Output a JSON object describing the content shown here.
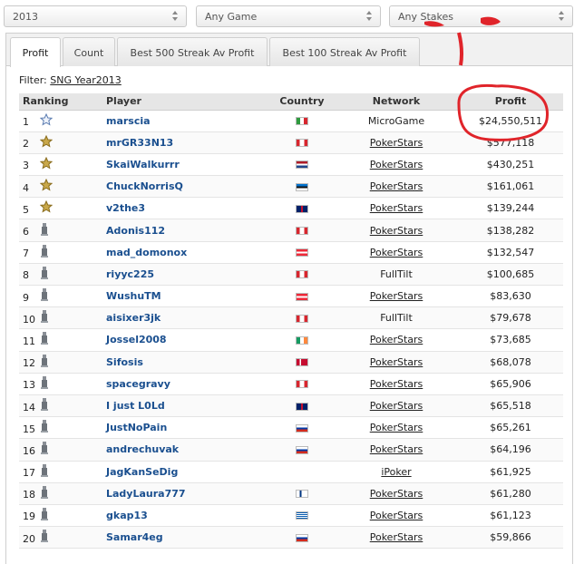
{
  "filters": {
    "year": "2013",
    "game": "Any Game",
    "stakes": "Any Stakes"
  },
  "tabs": [
    {
      "label": "Profit",
      "active": true
    },
    {
      "label": "Count",
      "active": false
    },
    {
      "label": "Best 500 Streak Av Profit",
      "active": false
    },
    {
      "label": "Best 100 Streak Av Profit",
      "active": false
    }
  ],
  "filter_line": {
    "label": "Filter:",
    "value": "SNG Year2013"
  },
  "table": {
    "headers": [
      "Ranking",
      "Player",
      "Country",
      "Network",
      "Profit"
    ],
    "rows": [
      {
        "rank": "1",
        "badge": "star-outline",
        "player": "marscia",
        "country": "italy",
        "network": "MicroGame",
        "network_link": false,
        "profit": "$24,550,511"
      },
      {
        "rank": "2",
        "badge": "star-gold",
        "player": "mrGR33N13",
        "country": "canada",
        "network": "PokerStars",
        "network_link": true,
        "profit": "$577,118"
      },
      {
        "rank": "3",
        "badge": "star-gold",
        "player": "SkaiWalkurrr",
        "country": "netherlands",
        "network": "PokerStars",
        "network_link": true,
        "profit": "$430,251"
      },
      {
        "rank": "4",
        "badge": "star-gold",
        "player": "ChuckNorrisQ",
        "country": "estonia",
        "network": "PokerStars",
        "network_link": true,
        "profit": "$161,061"
      },
      {
        "rank": "5",
        "badge": "star-gold",
        "player": "v2the3",
        "country": "uk",
        "network": "PokerStars",
        "network_link": true,
        "profit": "$139,244"
      },
      {
        "rank": "6",
        "badge": "figure",
        "player": "Adonis112",
        "country": "canada",
        "network": "PokerStars",
        "network_link": true,
        "profit": "$138,282"
      },
      {
        "rank": "7",
        "badge": "figure",
        "player": "mad_domonox",
        "country": "austria",
        "network": "PokerStars",
        "network_link": true,
        "profit": "$132,547"
      },
      {
        "rank": "8",
        "badge": "figure",
        "player": "riyyc225",
        "country": "canada",
        "network": "FullTilt",
        "network_link": false,
        "profit": "$100,685"
      },
      {
        "rank": "9",
        "badge": "figure",
        "player": "WushuTM",
        "country": "austria",
        "network": "PokerStars",
        "network_link": true,
        "profit": "$83,630"
      },
      {
        "rank": "10",
        "badge": "figure",
        "player": "aisixer3jk",
        "country": "canada",
        "network": "FullTilt",
        "network_link": false,
        "profit": "$79,678"
      },
      {
        "rank": "11",
        "badge": "figure",
        "player": "Jossel2008",
        "country": "ireland",
        "network": "PokerStars",
        "network_link": true,
        "profit": "$73,685"
      },
      {
        "rank": "12",
        "badge": "figure",
        "player": "Sifosis",
        "country": "denmark",
        "network": "PokerStars",
        "network_link": true,
        "profit": "$68,078"
      },
      {
        "rank": "13",
        "badge": "figure",
        "player": "spacegravy",
        "country": "canada",
        "network": "PokerStars",
        "network_link": true,
        "profit": "$65,906"
      },
      {
        "rank": "14",
        "badge": "figure",
        "player": "I just L0Ld",
        "country": "uk",
        "network": "PokerStars",
        "network_link": true,
        "profit": "$65,518"
      },
      {
        "rank": "15",
        "badge": "figure",
        "player": "JustNoPain",
        "country": "russia",
        "network": "PokerStars",
        "network_link": true,
        "profit": "$65,261"
      },
      {
        "rank": "16",
        "badge": "figure",
        "player": "andrechuvak",
        "country": "russia",
        "network": "PokerStars",
        "network_link": true,
        "profit": "$64,196"
      },
      {
        "rank": "17",
        "badge": "figure",
        "player": "JagKanSeDig",
        "country": "",
        "network": "iPoker",
        "network_link": true,
        "profit": "$61,925"
      },
      {
        "rank": "18",
        "badge": "figure",
        "player": "LadyLaura777",
        "country": "finland",
        "network": "PokerStars",
        "network_link": true,
        "profit": "$61,280"
      },
      {
        "rank": "19",
        "badge": "figure",
        "player": "gkap13",
        "country": "greece",
        "network": "PokerStars",
        "network_link": true,
        "profit": "$61,123"
      },
      {
        "rank": "20",
        "badge": "figure",
        "player": "Samar4eg",
        "country": "russia",
        "network": "PokerStars",
        "network_link": true,
        "profit": "$59,866"
      }
    ]
  },
  "colors": {
    "player_link": "#1a4f8f",
    "annotation": "#e0242a",
    "gold_star": "#c9a84a"
  }
}
